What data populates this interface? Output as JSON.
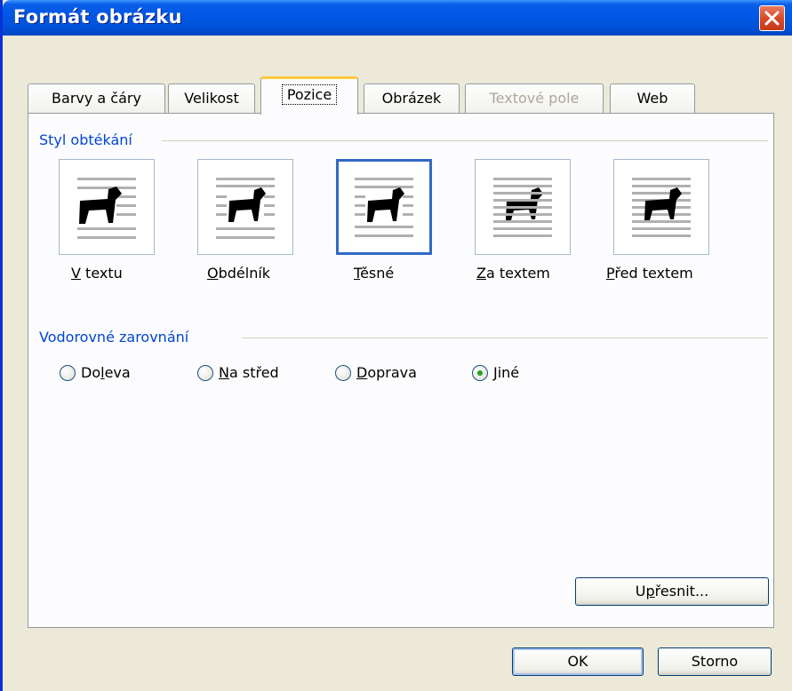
{
  "window": {
    "title": "Formát obrázku",
    "colors": {
      "title_bar": "#0058e6",
      "close_button": "#d84a26",
      "accent": "#0046d5",
      "active_tab_highlight": "#ffc83c"
    }
  },
  "tabs": [
    {
      "label": "Barvy a čáry",
      "active": false,
      "disabled": false
    },
    {
      "label": "Velikost",
      "active": false,
      "disabled": false
    },
    {
      "label": "Pozice",
      "active": true,
      "disabled": false
    },
    {
      "label": "Obrázek",
      "active": false,
      "disabled": false
    },
    {
      "label": "Textové pole",
      "active": false,
      "disabled": true
    },
    {
      "label": "Web",
      "active": false,
      "disabled": false
    }
  ],
  "wrap_section": {
    "title": "Styl obtékání",
    "options": [
      {
        "key": "V",
        "rest": " textu",
        "icon": "inline-dog-icon",
        "selected": false
      },
      {
        "key": "O",
        "rest": "bdélník",
        "icon": "square-dog-icon",
        "selected": false
      },
      {
        "key": "T",
        "rest": "ěsné",
        "icon": "tight-dog-icon",
        "selected": true
      },
      {
        "key": "Z",
        "rest": "a textem",
        "icon": "behind-text-dog-icon",
        "selected": false
      },
      {
        "key": "P",
        "rest": "řed textem",
        "icon": "front-text-dog-icon",
        "selected": false
      }
    ]
  },
  "align_section": {
    "title": "Vodorovné zarovnání",
    "options": [
      {
        "pre": "Do",
        "key": "l",
        "post": "eva",
        "checked": false
      },
      {
        "pre": "",
        "key": "N",
        "post": "a střed",
        "checked": false
      },
      {
        "pre": "",
        "key": "D",
        "post": "oprava",
        "checked": false
      },
      {
        "pre": "",
        "key": "J",
        "post": "iné",
        "checked": true
      }
    ]
  },
  "buttons": {
    "advanced": {
      "pre": "U",
      "key": "p",
      "post": "řesnit..."
    },
    "ok": "OK",
    "cancel": "Storno"
  }
}
